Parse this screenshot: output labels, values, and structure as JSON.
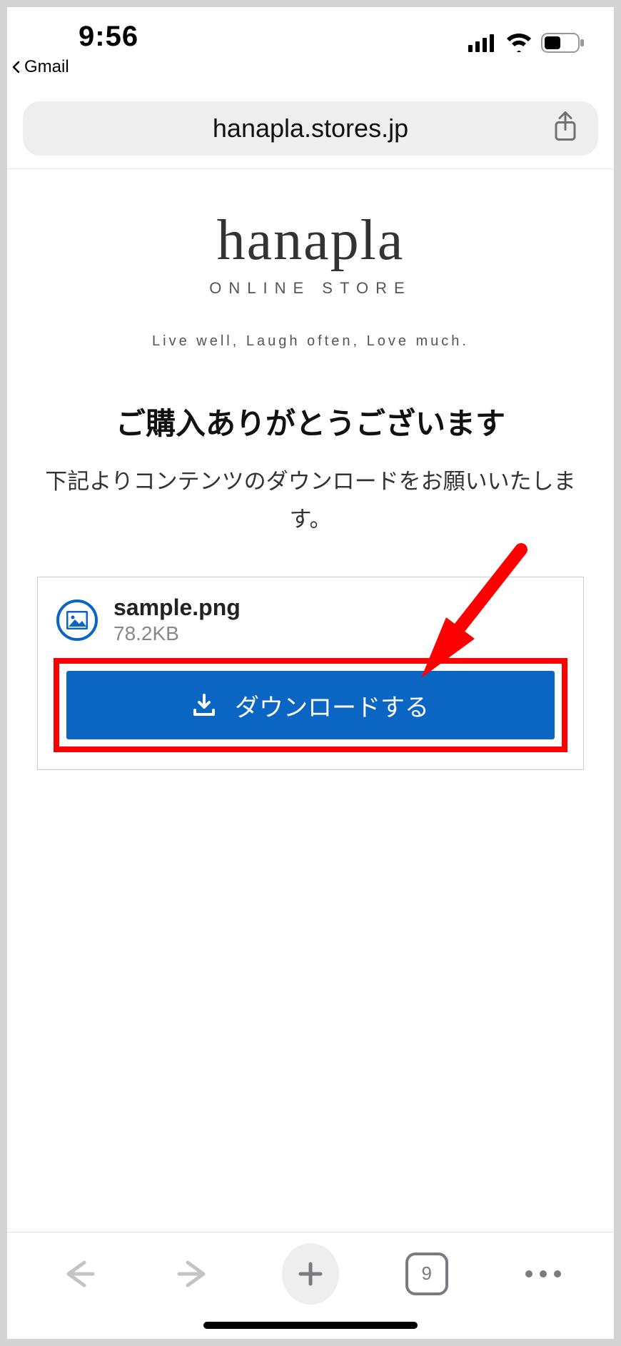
{
  "status": {
    "time": "9:56",
    "back_app": "Gmail"
  },
  "browser": {
    "url": "hanapla.stores.jp",
    "tab_count": "9"
  },
  "logo": {
    "script": "hanapla",
    "subtitle": "ONLINE STORE",
    "tagline": "Live well, Laugh often, Love much."
  },
  "page": {
    "title": "ご購入ありがとうございます",
    "subtitle": "下記よりコンテンツのダウンロードをお願いいたします。"
  },
  "file": {
    "name": "sample.png",
    "size": "78.2KB",
    "download_label": "ダウンロードする"
  }
}
